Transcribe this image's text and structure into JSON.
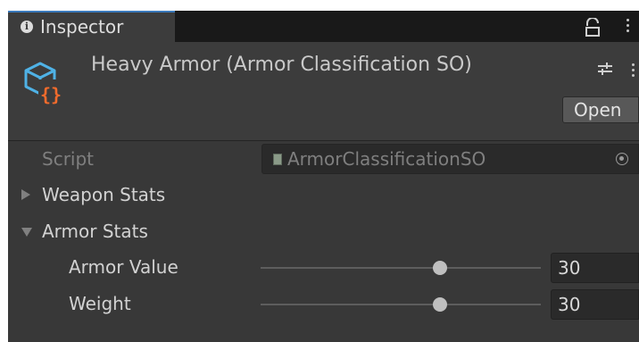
{
  "tab": {
    "title": "Inspector",
    "info_icon": "i"
  },
  "header": {
    "asset_title": "Heavy Armor (Armor Classification SO)",
    "open_label": "Open"
  },
  "fields": {
    "script": {
      "label": "Script",
      "value": "ArmorClassificationSO"
    },
    "weapon_stats": {
      "label": "Weapon Stats",
      "expanded": false
    },
    "armor_stats": {
      "label": "Armor Stats",
      "expanded": true
    },
    "armor_value": {
      "label": "Armor Value",
      "value": "30",
      "slider_fraction": 0.64
    },
    "weight": {
      "label": "Weight",
      "value": "30",
      "slider_fraction": 0.64
    }
  },
  "icons": {
    "tab": "info-icon",
    "lock": "lock-icon",
    "menu": "kebab-menu-icon",
    "asset": "scriptable-object-icon",
    "settings": "preset-settings-icon",
    "script": "script-file-icon",
    "picker": "object-picker-icon"
  },
  "colors": {
    "accent": "#3a79bb",
    "panel": "#383838",
    "icon_blue": "#4fb2e6",
    "icon_orange": "#f26b2c"
  }
}
